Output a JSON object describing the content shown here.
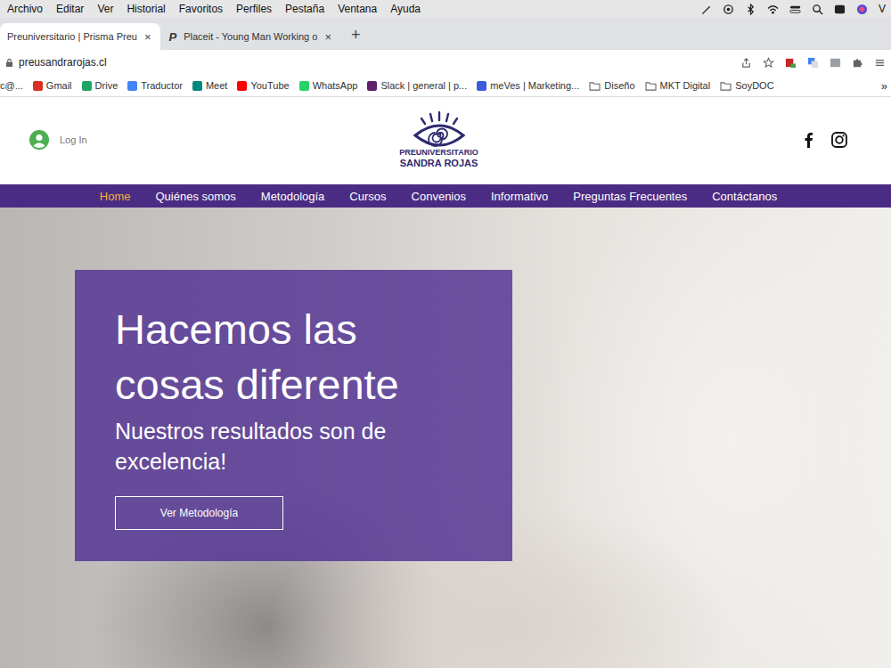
{
  "menu_bar": {
    "items": [
      "Archivo",
      "Editar",
      "Ver",
      "Historial",
      "Favoritos",
      "Perfiles",
      "Pestaña",
      "Ventana",
      "Ayuda"
    ],
    "user": "V"
  },
  "tabs": [
    {
      "label": "Preuniversitario | Prisma Preu",
      "favicon": "",
      "close": "×",
      "selected": true
    },
    {
      "label": "Placeit - Young Man Working o",
      "favicon": "P",
      "close": "×",
      "selected": false
    }
  ],
  "new_tab": "+",
  "address_bar": {
    "url": "preusandrarojas.cl"
  },
  "bookmarks": [
    {
      "label": "c@...",
      "kind": "cut",
      "color": "#888888"
    },
    {
      "label": "Gmail",
      "kind": "link",
      "color": "#d93025"
    },
    {
      "label": "Drive",
      "kind": "link",
      "color": "#1fa463"
    },
    {
      "label": "Traductor",
      "kind": "link",
      "color": "#4285f4"
    },
    {
      "label": "Meet",
      "kind": "link",
      "color": "#00897b"
    },
    {
      "label": "YouTube",
      "kind": "link",
      "color": "#ff0000"
    },
    {
      "label": "WhatsApp",
      "kind": "link",
      "color": "#25d366"
    },
    {
      "label": "Slack | general | p...",
      "kind": "link",
      "color": "#611f69"
    },
    {
      "label": "meVes | Marketing...",
      "kind": "link",
      "color": "#3b5bdb"
    },
    {
      "label": "Diseño",
      "kind": "folder",
      "color": "#666666"
    },
    {
      "label": "MKT Digital",
      "kind": "folder",
      "color": "#666666"
    },
    {
      "label": "SoyDOC",
      "kind": "folder",
      "color": "#666666"
    }
  ],
  "bookmarks_overflow": "»",
  "site": {
    "login": "Log In",
    "logo": {
      "line1": "PREUNIVERSITARIO",
      "line2": "SANDRA ROJAS"
    },
    "nav": [
      {
        "label": "Home",
        "selected": true
      },
      {
        "label": "Quiénes somos",
        "selected": false
      },
      {
        "label": "Metodología",
        "selected": false
      },
      {
        "label": "Cursos",
        "selected": false
      },
      {
        "label": "Convenios",
        "selected": false
      },
      {
        "label": "Informativo",
        "selected": false
      },
      {
        "label": "Preguntas Frecuentes",
        "selected": false
      },
      {
        "label": "Contáctanos",
        "selected": false
      }
    ],
    "hero": {
      "title": "Hacemos las cosas diferente",
      "subtitle": "Nuestros resultados son de excelencia!",
      "button": "Ver Metodología"
    }
  }
}
